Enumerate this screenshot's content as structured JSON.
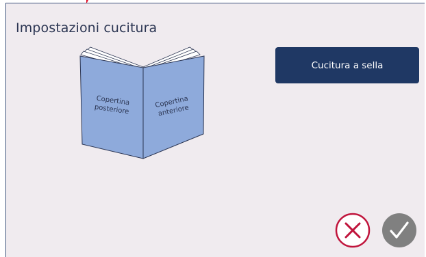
{
  "dialog": {
    "title": "Impostazioni cucitura"
  },
  "book": {
    "back_cover_label_line1": "Copertina",
    "back_cover_label_line2": "posteriore",
    "front_cover_label_line1": "Copertina",
    "front_cover_label_line2": "anteriore"
  },
  "binding_option": {
    "label": "Cucitura a sella"
  },
  "actions": {
    "cancel_icon": "close-circle-icon",
    "confirm_icon": "check-circle-icon"
  },
  "colors": {
    "background": "#f0ebef",
    "accent": "#1f3864",
    "book_fill": "#8eaadb",
    "cancel": "#c0143c",
    "confirm": "#808080"
  }
}
